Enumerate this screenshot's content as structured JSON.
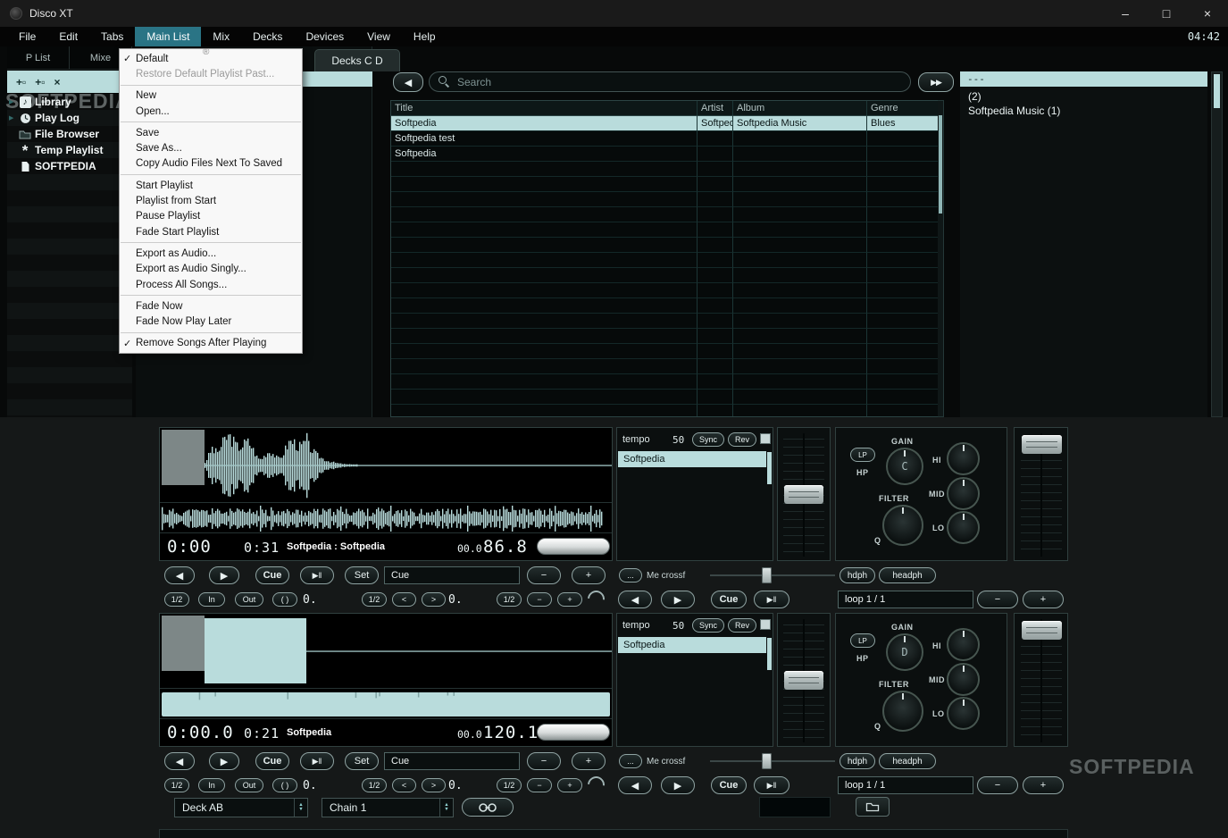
{
  "window": {
    "title": "Disco XT",
    "clock": "04:42",
    "minimize": "–",
    "maximize": "□",
    "close": "×"
  },
  "menubar": {
    "items": [
      "File",
      "Edit",
      "Tabs",
      "Main List",
      "Mix",
      "Decks",
      "Devices",
      "View",
      "Help"
    ],
    "active": "Main List"
  },
  "main_list_menu": {
    "groups": [
      [
        {
          "label": "Default",
          "checked": true
        },
        {
          "label": "Restore Default Playlist Past...",
          "disabled": true
        }
      ],
      [
        {
          "label": "New"
        },
        {
          "label": "Open..."
        }
      ],
      [
        {
          "label": "Save"
        },
        {
          "label": "Save As..."
        },
        {
          "label": "Copy Audio Files Next To Saved"
        }
      ],
      [
        {
          "label": "Start Playlist"
        },
        {
          "label": "Playlist from Start"
        },
        {
          "label": "Pause Playlist"
        },
        {
          "label": "Fade Start Playlist"
        }
      ],
      [
        {
          "label": "Export as Audio..."
        },
        {
          "label": "Export as Audio Singly..."
        },
        {
          "label": "Process All Songs..."
        }
      ],
      [
        {
          "label": "Fade Now"
        },
        {
          "label": "Fade Now Play Later"
        }
      ],
      [
        {
          "label": "Remove Songs After Playing",
          "checked": true
        }
      ]
    ]
  },
  "sidebar": {
    "tabs": [
      "P List",
      "Mixe"
    ],
    "toolbar": [
      {
        "icon": "add-playlist-icon",
        "glyph": "+▫"
      },
      {
        "icon": "add-folder-icon",
        "glyph": "+▫"
      },
      {
        "icon": "delete-icon",
        "glyph": "×"
      }
    ],
    "items": [
      {
        "icon": "note-icon",
        "label": "Library",
        "expander": true
      },
      {
        "icon": "clock-icon",
        "label": "Play Log",
        "expander": true
      },
      {
        "icon": "folder-icon",
        "label": "File Browser"
      },
      {
        "icon": "asterisk-icon",
        "label": "Temp Playlist"
      },
      {
        "icon": "document-icon",
        "label": "SOFTPEDIA"
      }
    ]
  },
  "decks_tab_label": "Decks C D",
  "browser": {
    "back": "◀",
    "forward": "▶▶",
    "search_placeholder": "Search",
    "columns": [
      "Title",
      "Artist",
      "Album",
      "Genre"
    ],
    "rows": [
      {
        "title": "Softpedia",
        "artist": "Softpedia",
        "album": "Softpedia Music",
        "genre": "Blues",
        "selected": true
      },
      {
        "title": "Softpedia test",
        "artist": "",
        "album": "",
        "genre": "",
        "selected": false
      },
      {
        "title": "Softpedia",
        "artist": "",
        "album": "",
        "genre": "",
        "selected": false
      }
    ]
  },
  "right_panel": {
    "header": "---",
    "lines": [
      "(2)",
      "Softpedia Music (1)"
    ]
  },
  "decks": [
    {
      "id": "deck-c",
      "waveform": "peaks",
      "tempo_label": "tempo",
      "tempo_value": "50",
      "sync_label": "Sync",
      "rev_label": "Rev",
      "track": "Softpedia",
      "elapsed": "0:00",
      "cue_time": "0:31",
      "title_display": "Softpedia : Softpedia",
      "pitch": "00.0",
      "bpm": "86.8",
      "knob_letter": "C",
      "loop_display": "loop 1 / 1",
      "offset_a": "0.",
      "offset_b": "0."
    },
    {
      "id": "deck-d",
      "waveform": "solid",
      "tempo_label": "tempo",
      "tempo_value": "50",
      "sync_label": "Sync",
      "rev_label": "Rev",
      "track": "Softpedia",
      "elapsed": "0:00.0",
      "cue_time": "0:21",
      "title_display": "Softpedia",
      "pitch": "00.0",
      "bpm": "120.1",
      "knob_letter": "D",
      "loop_display": "loop 1 / 1",
      "offset_a": "0.",
      "offset_b": "0."
    }
  ],
  "deck_controls": {
    "prev": "◀",
    "next": "▶",
    "cue": "Cue",
    "playpause": "▶‖",
    "set": "Set",
    "cue_field": "Cue",
    "minus": "−",
    "plus": "+",
    "dots": "...",
    "me_crossf": "Me crossf",
    "hdph": "hdph",
    "headph": "headph",
    "half": "1/2",
    "in_label": "In",
    "out_label": "Out",
    "paren": "( )",
    "lt": "<",
    "gt": ">"
  },
  "eq": {
    "gain": "GAIN",
    "filter": "FILTER",
    "q": "Q",
    "hi": "HI",
    "mid": "MID",
    "lo": "LO",
    "lp": "LP",
    "hp": "HP"
  },
  "bottom_bar": {
    "deck_select": "Deck AB",
    "chain_select": "Chain 1"
  },
  "watermark": "SOFTPEDIA",
  "watermark_r": "®",
  "colors": {
    "accent": "#b9dcdc",
    "menu_highlight": "#2a7485"
  }
}
